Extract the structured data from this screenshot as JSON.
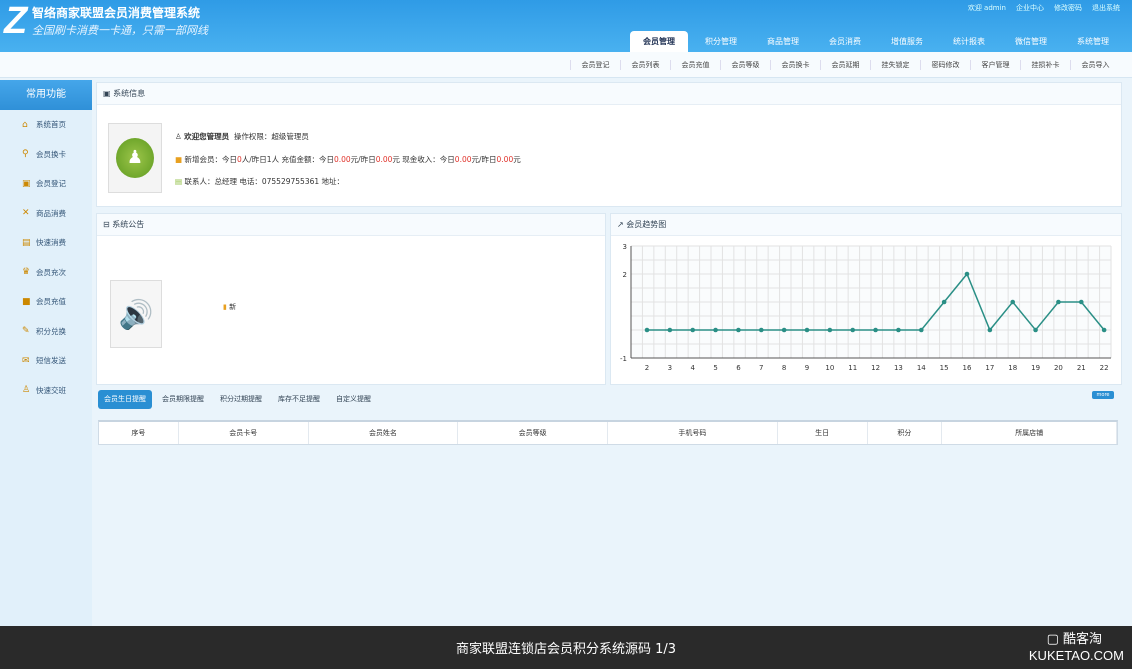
{
  "header": {
    "logo": "Z",
    "title": "智络商家联盟会员消费管理系统",
    "slogan": "全国刷卡消费一卡通，只需一部网线",
    "top_links": [
      "欢迎 admin",
      "企业中心",
      "修改密码",
      "退出系统"
    ],
    "tabs": [
      "会员管理",
      "积分管理",
      "商品管理",
      "会员消费",
      "增值服务",
      "统计报表",
      "微信管理",
      "系统管理"
    ],
    "active_tab": 0
  },
  "subnav": [
    "会员登记",
    "会员列表",
    "会员充值",
    "会员等级",
    "会员换卡",
    "会员延期",
    "挂失锁定",
    "密码修改",
    "客户管理",
    "挂损补卡",
    "会员导入"
  ],
  "sidebar": {
    "title": "常用功能",
    "items": [
      {
        "label": "系统首页",
        "icon": "⌂"
      },
      {
        "label": "会员换卡",
        "icon": "⚲"
      },
      {
        "label": "会员登记",
        "icon": "▣"
      },
      {
        "label": "商品消费",
        "icon": "✕"
      },
      {
        "label": "快速消费",
        "icon": "▤"
      },
      {
        "label": "会员充次",
        "icon": "♛"
      },
      {
        "label": "会员充值",
        "icon": "■"
      },
      {
        "label": "积分兑换",
        "icon": "✎"
      },
      {
        "label": "短信发送",
        "icon": "✉"
      },
      {
        "label": "快速交班",
        "icon": "♙"
      }
    ]
  },
  "system_info": {
    "title": "系统信息",
    "user": "欢迎您管理员",
    "permission": "操作权限：超级管理员",
    "stats": {
      "l1": "新增会员：今日",
      "today_new": "0",
      "l2": "人/昨日",
      "yesterday_new": "1",
      "l3": "人 充值金额：今日",
      "today_recharge": "0.00",
      "l4": "元/昨日",
      "yesterday_recharge": "0.00",
      "l5": "元 现金收入：今日",
      "today_cash": "0.00",
      "l6": "元/昨日",
      "yesterday_cash": "0.00",
      "l7": "元"
    },
    "contact": "联系人：总经理  电话：075529755361  地址："
  },
  "notice": {
    "title": "系统公告",
    "item": "新"
  },
  "chart_panel": {
    "title": "会员趋势图"
  },
  "chart_data": {
    "type": "line",
    "title": "会员趋势图",
    "x": [
      2,
      3,
      4,
      5,
      6,
      7,
      8,
      9,
      10,
      11,
      12,
      13,
      14,
      15,
      16,
      17,
      18,
      19,
      20,
      21,
      22
    ],
    "values": [
      0,
      0,
      0,
      0,
      0,
      0,
      0,
      0,
      0,
      0,
      0,
      0,
      0,
      1,
      2,
      0,
      1,
      0,
      1,
      1,
      0
    ],
    "ylim": [
      -1,
      3
    ],
    "ytick_labels": [
      "3",
      "2",
      "-1"
    ],
    "grid": true,
    "color": "#2a8f86"
  },
  "reminders": {
    "tabs": [
      "会员生日提醒",
      "会员期限提醒",
      "积分过期提醒",
      "库存不足提醒",
      "自定义提醒"
    ],
    "more": "more",
    "columns": [
      "序号",
      "会员卡号",
      "会员姓名",
      "会员等级",
      "手机号码",
      "生日",
      "积分",
      "所属店铺"
    ]
  },
  "footer": {
    "caption": "商家联盟连锁店会员积分系统源码   1/3",
    "watermark": "酷客淘",
    "watermark_url": "KUKETAO.COM"
  }
}
